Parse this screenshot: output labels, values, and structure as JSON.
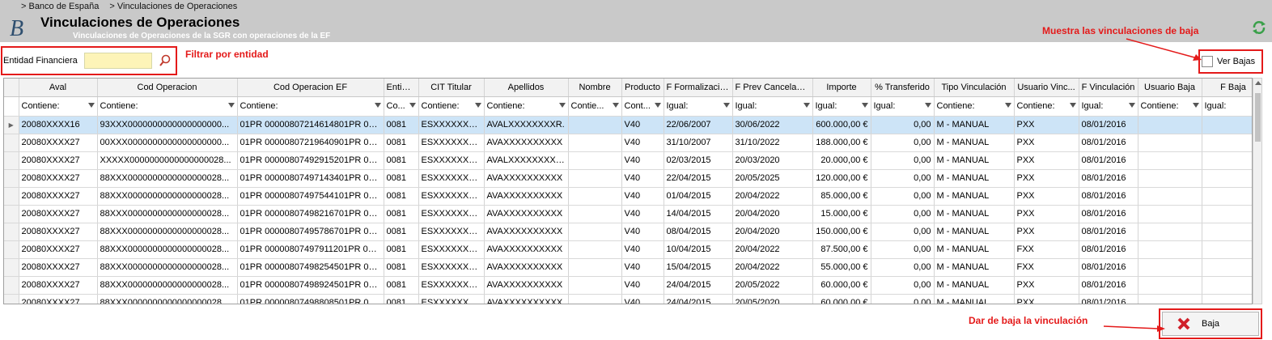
{
  "breadcrumb": [
    "> Banco de España",
    "> Vinculaciones de Operaciones"
  ],
  "logo": "B",
  "page_title": "Vinculaciones de Operaciones",
  "page_subtitle": "Vinculaciones de Operaciones de la SGR con operaciones de la EF",
  "filter": {
    "label": "Entidad Financiera",
    "value": "",
    "placeholder": ""
  },
  "ver_bajas_label": "Ver Bajas",
  "ver_bajas_checked": false,
  "baja_button_label": "Baja",
  "annotations": {
    "filter": "Filtrar por entidad",
    "ver_bajas": "Muestra las vinculaciones de baja",
    "baja": "Dar de baja la vinculación"
  },
  "colors": {
    "annotation": "#e41a1a",
    "header_bg": "#c9c9c9",
    "filter_bg": "#fdf4b8",
    "selected_row": "#cde4f7"
  },
  "grid": {
    "columns": [
      "Aval",
      "Cod Operacion",
      "Cod Operacion EF",
      "Entidad",
      "CIT Titular",
      "Apellidos",
      "Nombre",
      "Producto",
      "F Formalización",
      "F Prev Cancelación",
      "Importe",
      "% Transferido",
      "Tipo Vinculación",
      "Usuario Vinc...",
      "F Vinculación",
      "Usuario Baja",
      "F Baja"
    ],
    "filters": [
      "Contiene:",
      "Contiene:",
      "Contiene:",
      "Co...",
      "Contiene:",
      "Contiene:",
      "Contie...",
      "Cont...",
      "Igual:",
      "Igual:",
      "Igual:",
      "Igual:",
      "Contiene:",
      "Contiene:",
      "Igual:",
      "Contiene:",
      "Igual:"
    ],
    "rows": [
      [
        "20080XXXX16",
        "93XXX0000000000000000000...",
        "01PR 00000807214614801PR 000...",
        "0081",
        "ESXXXXXXXXX",
        "AVALXXXXXXXXR.",
        "",
        "V40",
        "22/06/2007",
        "30/06/2022",
        "600.000,00 €",
        "0,00",
        "M - MANUAL",
        "PXX",
        "08/01/2016",
        "",
        ""
      ],
      [
        "20080XXXX27",
        "00XXX0000000000000000000...",
        "01PR 00000807219640901PR 000...",
        "0081",
        "ESXXXXXXXXX",
        "AVAXXXXXXXXXX",
        "",
        "V40",
        "31/10/2007",
        "31/10/2022",
        "188.000,00 €",
        "0,00",
        "M - MANUAL",
        "PXX",
        "08/01/2016",
        "",
        ""
      ],
      [
        "20080XXXX27",
        "XXXXX0000000000000000028...",
        "01PR 00000807492915201PR 000...",
        "0081",
        "ESXXXXXXXXX",
        "AVALXXXXXXXXXX",
        "",
        "V40",
        "02/03/2015",
        "20/03/2020",
        "20.000,00 €",
        "0,00",
        "M - MANUAL",
        "PXX",
        "08/01/2016",
        "",
        ""
      ],
      [
        "20080XXXX27",
        "88XXX0000000000000000028...",
        "01PR 00000807497143401PR 000...",
        "0081",
        "ESXXXXXXXXX",
        "AVAXXXXXXXXXX",
        "",
        "V40",
        "22/04/2015",
        "20/05/2025",
        "120.000,00 €",
        "0,00",
        "M - MANUAL",
        "PXX",
        "08/01/2016",
        "",
        ""
      ],
      [
        "20080XXXX27",
        "88XXX0000000000000000028...",
        "01PR 00000807497544101PR 000...",
        "0081",
        "ESXXXXXXXXX",
        "AVAXXXXXXXXXX",
        "",
        "V40",
        "01/04/2015",
        "20/04/2022",
        "85.000,00 €",
        "0,00",
        "M - MANUAL",
        "PXX",
        "08/01/2016",
        "",
        ""
      ],
      [
        "20080XXXX27",
        "88XXX0000000000000000028...",
        "01PR 00000807498216701PR 000...",
        "0081",
        "ESXXXXXXXXX",
        "AVAXXXXXXXXXX",
        "",
        "V40",
        "14/04/2015",
        "20/04/2020",
        "15.000,00 €",
        "0,00",
        "M - MANUAL",
        "PXX",
        "08/01/2016",
        "",
        ""
      ],
      [
        "20080XXXX27",
        "88XXX0000000000000000028...",
        "01PR 00000807495786701PR 000...",
        "0081",
        "ESXXXXXXXXX",
        "AVAXXXXXXXXXX",
        "",
        "V40",
        "08/04/2015",
        "20/04/2020",
        "150.000,00 €",
        "0,00",
        "M - MANUAL",
        "PXX",
        "08/01/2016",
        "",
        ""
      ],
      [
        "20080XXXX27",
        "88XXX0000000000000000028...",
        "01PR 00000807497911201PR 000...",
        "0081",
        "ESXXXXXXXXX",
        "AVAXXXXXXXXXX",
        "",
        "V40",
        "10/04/2015",
        "20/04/2022",
        "87.500,00 €",
        "0,00",
        "M - MANUAL",
        "FXX",
        "08/01/2016",
        "",
        ""
      ],
      [
        "20080XXXX27",
        "88XXX0000000000000000028...",
        "01PR 00000807498254501PR 000...",
        "0081",
        "ESXXXXXXXXX",
        "AVAXXXXXXXXXX",
        "",
        "V40",
        "15/04/2015",
        "20/04/2022",
        "55.000,00 €",
        "0,00",
        "M - MANUAL",
        "FXX",
        "08/01/2016",
        "",
        ""
      ],
      [
        "20080XXXX27",
        "88XXX0000000000000000028...",
        "01PR 00000807498924501PR 000...",
        "0081",
        "ESXXXXXXXXX",
        "AVAXXXXXXXXXX",
        "",
        "V40",
        "24/04/2015",
        "20/05/2022",
        "60.000,00 €",
        "0,00",
        "M - MANUAL",
        "PXX",
        "08/01/2016",
        "",
        ""
      ],
      [
        "20080XXXX27",
        "88XXX0000000000000000028...",
        "01PR 00000807498808501PR 000...",
        "0081",
        "ESXXXXXXXXX",
        "AVAXXXXXXXXXX",
        "",
        "V40",
        "24/04/2015",
        "20/05/2020",
        "60.000,00 €",
        "0,00",
        "M - MANUAL",
        "PXX",
        "08/01/2016",
        "",
        ""
      ]
    ],
    "selected_row": 0,
    "numeric_columns": [
      10,
      11
    ]
  }
}
